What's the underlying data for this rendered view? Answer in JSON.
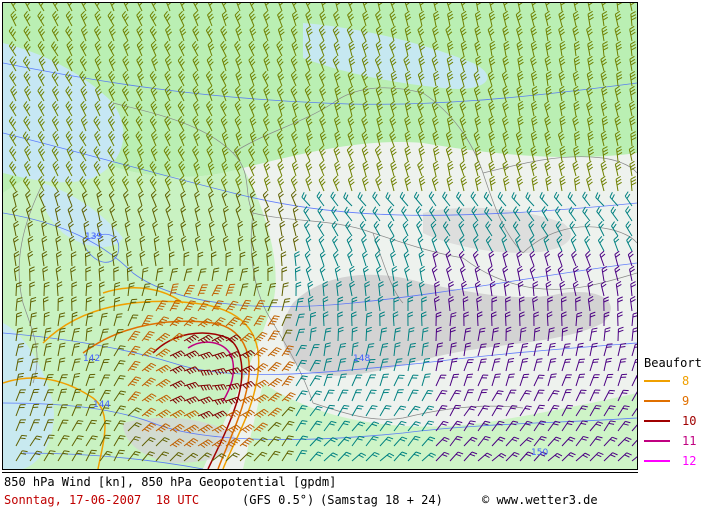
{
  "title": "850 hPa Wind [kn], 850 hPa Geopotential [gpdm]",
  "date": "Sonntag, 17-06-2007  18 UTC",
  "model": "(GFS 0.5°)",
  "run": "(Samstag 18 + 24)",
  "copyright": "© www.wetter3.de",
  "legend": {
    "title": "Beaufort",
    "items": [
      {
        "label": "8",
        "color": "#f0a000"
      },
      {
        "label": "9",
        "color": "#e07000"
      },
      {
        "label": "10",
        "color": "#a00000"
      },
      {
        "label": "11",
        "color": "#c00080"
      },
      {
        "label": "12",
        "color": "#ff00ff"
      }
    ]
  },
  "contour_labels": [
    "139",
    "142",
    "144",
    "148",
    "150"
  ],
  "colors": {
    "land_green": "#b8f0b0",
    "sea_blue": "#c8e8ff",
    "mountain_grey": "#c8c8c8",
    "barb_teal": "#008080",
    "barb_olive": "#708000",
    "barb_purple": "#4b0082",
    "barb_orange": "#c06000",
    "barb_darkred": "#800000",
    "contour_blue": "#4060ff",
    "strong_orange": "#f0a000"
  }
}
